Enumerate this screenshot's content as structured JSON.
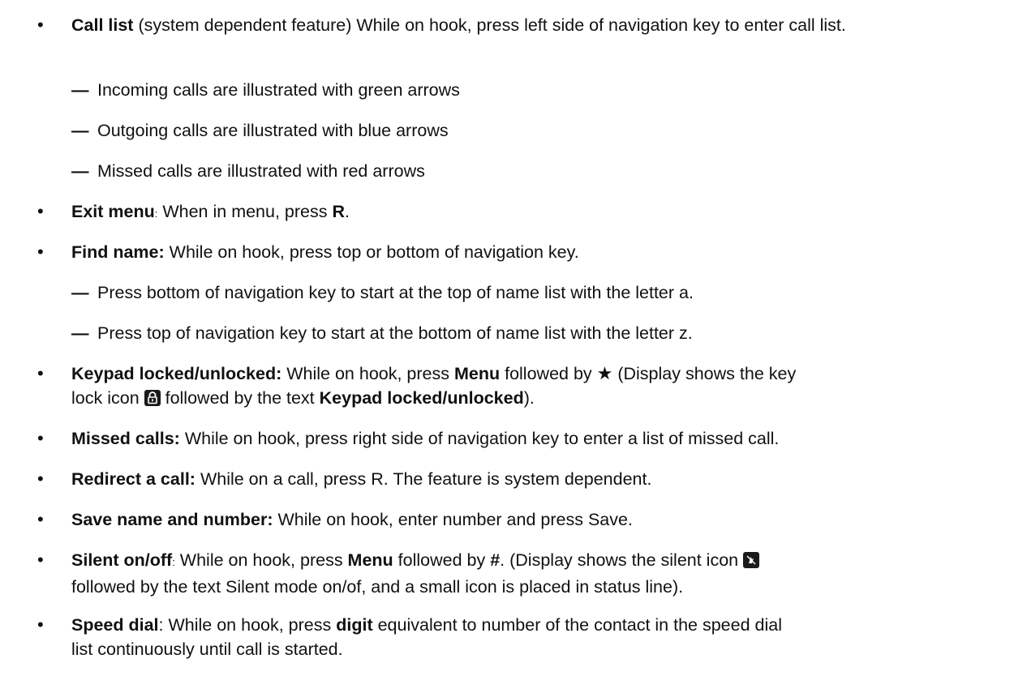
{
  "bullet_glyph": "•",
  "dash_glyph": "—",
  "star_glyph": "★",
  "items": [
    {
      "bold": "Call list",
      "text": " (system dependent feature) While on hook, press left side of navigation key to enter call list."
    },
    {
      "bold": "Exit menu",
      "colon": ":",
      "text1": " When in menu, press ",
      "bold2": "R",
      "text2": "."
    },
    {
      "bold": "Find name:",
      "text": " While on hook, press top or bottom of navigation key."
    },
    {
      "bold": "Keypad locked/unlocked:",
      "text1": " While on hook, press ",
      "bold2": "Menu",
      "text2": " followed by ",
      "text3": " (Display shows the key",
      "text4": "lock icon ",
      "text5": " followed by the text ",
      "bold3": "Keypad locked/unlocked",
      "text6": ")."
    },
    {
      "bold": "Missed calls:",
      "text": " While on hook, press right side of navigation key to enter a list of missed call."
    },
    {
      "bold": "Redirect a call:",
      "text": " While on a call, press R. The feature is system dependent."
    },
    {
      "bold": "Save name and number:",
      "text": " While on hook, enter number and press Save."
    },
    {
      "bold": "Silent on/off",
      "colon": ":",
      "text1": " While on hook, press ",
      "bold2": "Menu",
      "text2": " followed by ",
      "bold3": "#",
      "text3": ". (Display shows the silent icon ",
      "text4": "followed by the text Silent mode on/of, and a small icon is placed in status line)."
    },
    {
      "bold": "Speed dial",
      "text1": ": While on hook, press ",
      "bold2": "digit",
      "text2": " equivalent to number of the contact in the speed dial",
      "text3": "list continuously until call is started."
    }
  ],
  "call_list_subs": [
    "Incoming calls are illustrated with green arrows",
    "Outgoing calls are illustrated with blue arrows",
    "Missed calls are illustrated with red arrows"
  ],
  "find_name_subs": [
    "Press bottom of navigation key to start at the top of name list with the letter a.",
    "Press top of navigation key to start at the bottom of name list with the letter z."
  ],
  "icons": {
    "lock": "lock-icon",
    "silent": "silent-icon",
    "star": "star-icon"
  }
}
